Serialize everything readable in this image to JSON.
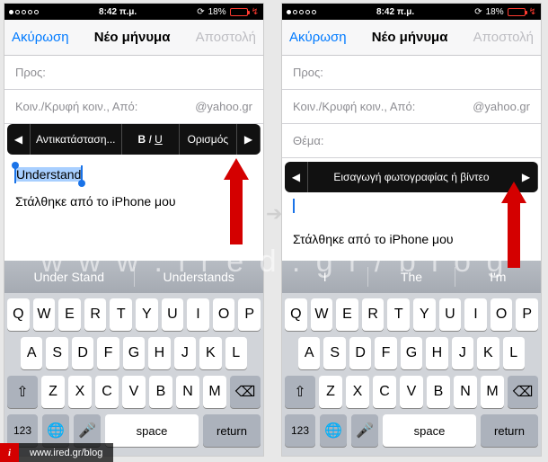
{
  "status": {
    "time": "8:42 π.μ.",
    "battery_pct": "18%"
  },
  "nav": {
    "cancel": "Ακύρωση",
    "title": "Νέο μήνυμα",
    "send": "Αποστολή"
  },
  "fields": {
    "to_label": "Προς:",
    "cc_label": "Κοιν./Κρυφή κοιν., Από:",
    "from_domain": "@yahoo.gr",
    "subject_label": "Θέμα:"
  },
  "left": {
    "ctx_items": [
      "Αντικατάσταση...",
      "B I U",
      "Ορισμός"
    ],
    "selected_word": "Understand",
    "suggestions": [
      "Under Stand",
      "Understands"
    ]
  },
  "right": {
    "ctx_label": "Εισαγωγή φωτογραφίας ή βίντεο",
    "suggestions": [
      "I",
      "The",
      "I'm"
    ]
  },
  "signature": "Στάλθηκε από το iPhone μου",
  "keyboard": {
    "row1": [
      "Q",
      "W",
      "E",
      "R",
      "T",
      "Y",
      "U",
      "I",
      "O",
      "P"
    ],
    "row2": [
      "A",
      "S",
      "D",
      "F",
      "G",
      "H",
      "J",
      "K",
      "L"
    ],
    "row3": [
      "Z",
      "X",
      "C",
      "V",
      "B",
      "N",
      "M"
    ],
    "k123": "123",
    "space": "space",
    "return": "return"
  },
  "watermark": "w w w . i r e d . g r / b l o g",
  "footer_url": "www.ired.gr/blog"
}
